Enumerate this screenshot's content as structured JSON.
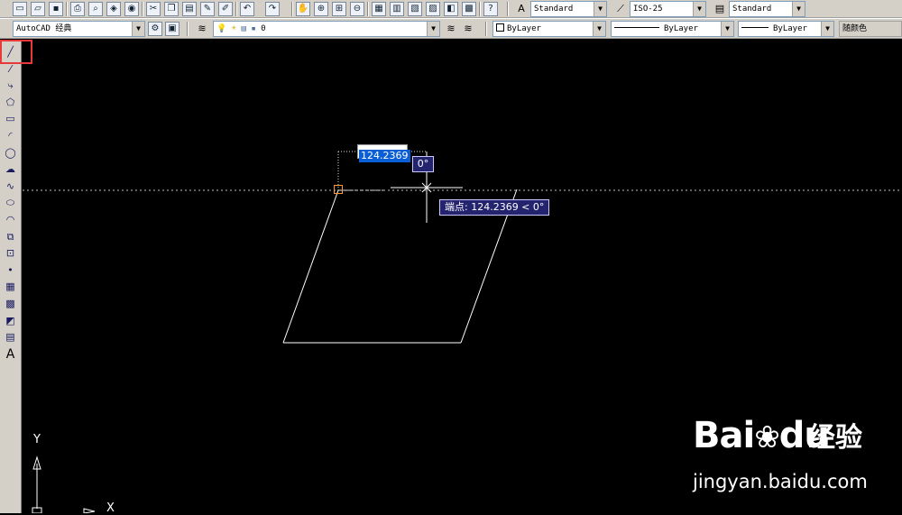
{
  "toolbar_top": {
    "text_style": "Standard",
    "dim_style": "ISO-25",
    "table_style": "Standard"
  },
  "toolbar_layers": {
    "workspace": "AutoCAD 经典",
    "layer": "0",
    "color": "ByLayer",
    "linetype": "ByLayer",
    "lineweight": "ByLayer",
    "plot_style": "随颜色"
  },
  "left_toolbar": {
    "tools": [
      "line-icon",
      "construction-line-icon",
      "polyline-icon",
      "polygon-icon",
      "rectangle-icon",
      "arc-icon",
      "circle-icon",
      "revision-cloud-icon",
      "spline-icon",
      "ellipse-icon",
      "ellipse-arc-icon",
      "insert-block-icon",
      "make-block-icon",
      "point-icon",
      "hatch-icon",
      "gradient-icon",
      "region-icon",
      "table-icon",
      "multiline-text-icon"
    ],
    "text_tool_glyph": "A"
  },
  "drawing": {
    "dynamic_input_value": "124.2369",
    "angle_value": "0°",
    "polar_tooltip": "端点: 124.2369 < 0°",
    "ucs_y_label": "Y",
    "ucs_x_label": "X",
    "background": "#000000",
    "line_color": "#ffffff",
    "highlight_color": "#e8383a"
  },
  "watermark": {
    "brand": "Bai",
    "brand_suffix": "du",
    "product": "经验",
    "url": "jingyan.baidu.com"
  }
}
